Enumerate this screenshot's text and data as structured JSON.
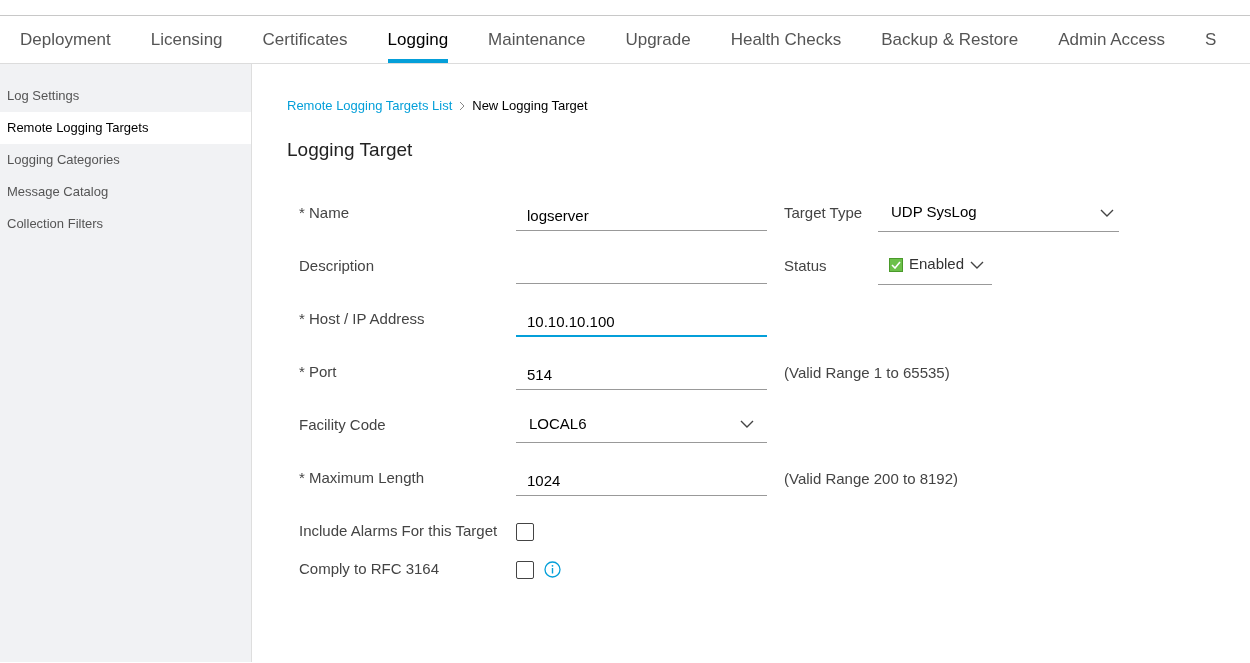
{
  "tabs": [
    {
      "label": "Deployment",
      "selected": false
    },
    {
      "label": "Licensing",
      "selected": false
    },
    {
      "label": "Certificates",
      "selected": false
    },
    {
      "label": "Logging",
      "selected": true
    },
    {
      "label": "Maintenance",
      "selected": false
    },
    {
      "label": "Upgrade",
      "selected": false
    },
    {
      "label": "Health Checks",
      "selected": false
    },
    {
      "label": "Backup & Restore",
      "selected": false
    },
    {
      "label": "Admin Access",
      "selected": false
    },
    {
      "label": "S",
      "selected": false
    }
  ],
  "sidebar": {
    "items": [
      {
        "label": "Log Settings",
        "selected": false
      },
      {
        "label": "Remote Logging Targets",
        "selected": true
      },
      {
        "label": "Logging Categories",
        "selected": false
      },
      {
        "label": "Message Catalog",
        "selected": false
      },
      {
        "label": "Collection Filters",
        "selected": false
      }
    ]
  },
  "breadcrumb": {
    "link": "Remote Logging Targets List",
    "current": "New Logging Target"
  },
  "title": "Logging Target",
  "form": {
    "rows": [
      {
        "label": "* Name",
        "field": {
          "kind": "text",
          "value": "logserver",
          "focused": false
        },
        "side": {
          "kind": "select",
          "label": "Target Type",
          "value": "UDP SysLog"
        }
      },
      {
        "label": "Description",
        "field": {
          "kind": "text",
          "focused": false
        },
        "side": {
          "kind": "status",
          "label": "Status",
          "value": "Enabled",
          "checked": true
        }
      },
      {
        "label": "* Host / IP Address",
        "field": {
          "kind": "text",
          "value": "10.10.10.100",
          "focused": true
        }
      },
      {
        "label": "* Port",
        "field": {
          "kind": "text",
          "value": "514",
          "focused": false
        },
        "side": {
          "kind": "hint",
          "text": "(Valid Range 1 to 65535)"
        }
      },
      {
        "label": "Facility Code",
        "field": {
          "kind": "select",
          "value": "LOCAL6"
        }
      },
      {
        "label": "* Maximum Length",
        "field": {
          "kind": "text",
          "value": "1024",
          "focused": false
        },
        "side": {
          "kind": "hint",
          "text": "(Valid Range 200 to 8192)"
        }
      }
    ],
    "checks": [
      {
        "label": "Include Alarms For this Target",
        "checked": false,
        "info": false
      },
      {
        "label": "Comply to RFC 3164",
        "checked": false,
        "info": true
      }
    ]
  }
}
